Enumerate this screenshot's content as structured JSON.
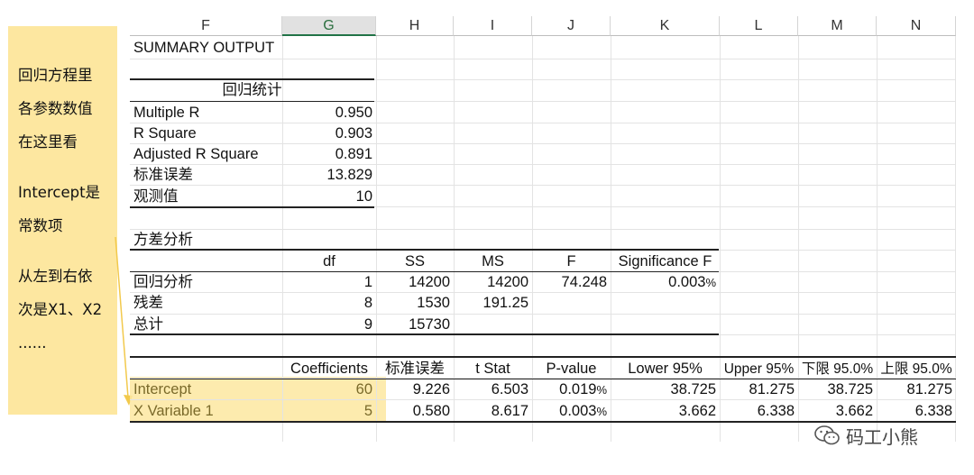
{
  "note": {
    "lines": [
      "回归方程里",
      "各参数数值",
      "在这里看",
      "",
      "Intercept是",
      "常数项",
      "",
      "从左到右依",
      "次是X1、X2",
      "......"
    ]
  },
  "columns": [
    "F",
    "G",
    "H",
    "I",
    "J",
    "K",
    "L",
    "M",
    "N"
  ],
  "selected_column": "G",
  "output": {
    "title": "SUMMARY OUTPUT",
    "regression_stats_title": "回归统计",
    "regression_stats": [
      {
        "label": "Multiple R",
        "value": "0.950"
      },
      {
        "label": "R Square",
        "value": "0.903"
      },
      {
        "label": "Adjusted R Square",
        "value": "0.891"
      },
      {
        "label": "标准误差",
        "value": "13.829"
      },
      {
        "label": "观测值",
        "value": "10"
      }
    ],
    "anova_title": "方差分析",
    "anova_headers": [
      "df",
      "SS",
      "MS",
      "F",
      "Significance F"
    ],
    "anova_rows": [
      {
        "label": "回归分析",
        "df": "1",
        "ss": "14200",
        "ms": "14200",
        "f": "74.248",
        "sig": "0.003",
        "sig_unit": "%"
      },
      {
        "label": "残差",
        "df": "8",
        "ss": "1530",
        "ms": "191.25",
        "f": "",
        "sig": "",
        "sig_unit": ""
      },
      {
        "label": "总计",
        "df": "9",
        "ss": "15730",
        "ms": "",
        "f": "",
        "sig": "",
        "sig_unit": ""
      }
    ],
    "coef_headers": [
      "Coefficients",
      "标准误差",
      "t Stat",
      "P-value",
      "Lower 95%",
      "Upper 95%",
      "下限 95.0%",
      "上限 95.0%"
    ],
    "coef_rows": [
      {
        "label": "Intercept",
        "coef": "60",
        "se": "9.226",
        "t": "6.503",
        "p": "0.019",
        "p_unit": "%",
        "lower": "38.725",
        "upper": "81.275",
        "lower2": "38.725",
        "upper2": "81.275"
      },
      {
        "label": "X Variable 1",
        "coef": "5",
        "se": "0.580",
        "t": "8.617",
        "p": "0.003",
        "p_unit": "%",
        "lower": "3.662",
        "upper": "6.338",
        "lower2": "3.662",
        "upper2": "6.338"
      }
    ]
  },
  "watermark": "码工小熊",
  "colors": {
    "highlight": "#fde7a0",
    "selected_header": "#217346"
  }
}
